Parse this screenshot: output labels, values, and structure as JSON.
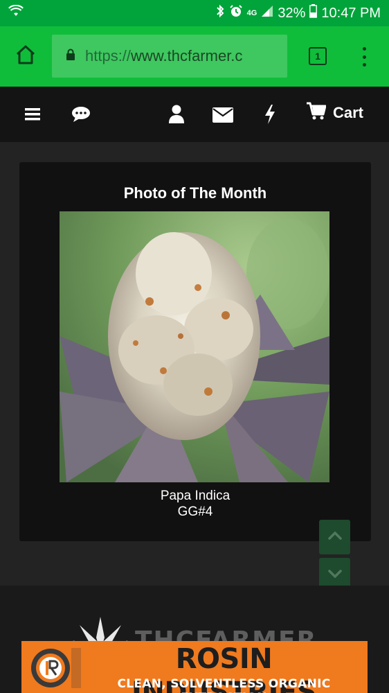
{
  "status_bar": {
    "battery": "32%",
    "time": "10:47 PM",
    "network": "4G"
  },
  "browser": {
    "url_scheme": "https://",
    "url_host": "www.thcfarmer.c",
    "tab_count": "1"
  },
  "site_nav": {
    "icons": [
      "menu-icon",
      "chat-icon",
      "user-icon",
      "mail-icon",
      "bolt-icon",
      "cart-icon"
    ],
    "cart_label": "Cart"
  },
  "photo_of_month": {
    "title": "Photo of The Month",
    "caption_line1": "Papa Indica",
    "caption_line2": "GG#4"
  },
  "footer": {
    "logo_text": "THCFARMER"
  },
  "ad": {
    "title": "ROSIN INDUSTRIES",
    "subtitle": "CLEAN, SOLVENTLESS ORGANIC EXTRACTION"
  },
  "colors": {
    "status_bar": "#00a43a",
    "chrome_bar": "#0fbd3b",
    "nav_bg": "#141414",
    "page_bg": "#232323",
    "card_bg": "#111111",
    "ad_bg": "#f07a1e"
  }
}
